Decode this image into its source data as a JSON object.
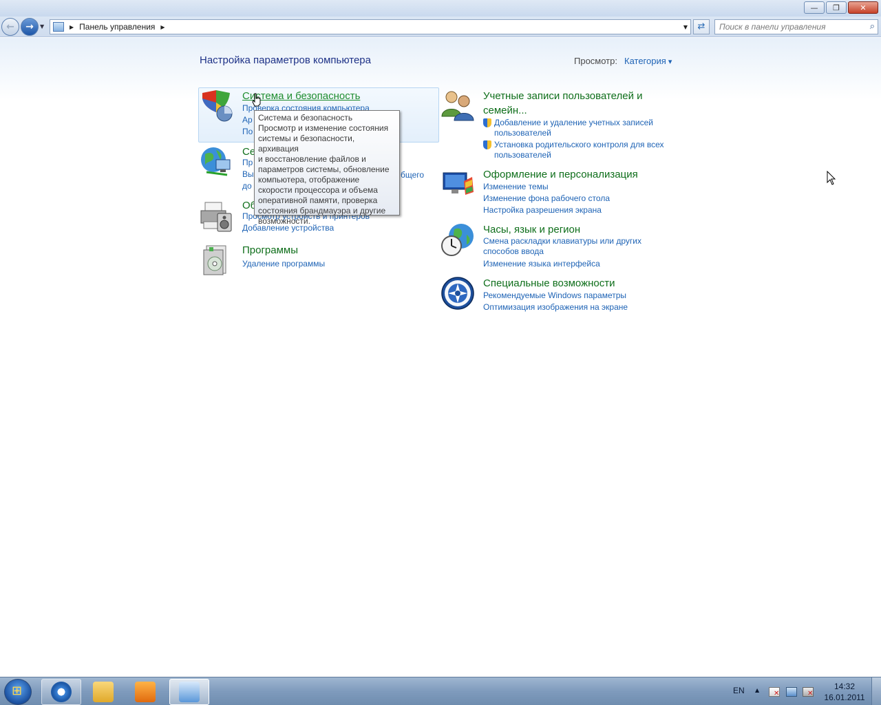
{
  "window": {
    "minimize_glyph": "—",
    "maximize_glyph": "❐",
    "close_glyph": "✕"
  },
  "nav": {
    "address_crumb": "Панель управления",
    "search_placeholder": "Поиск в панели управления"
  },
  "header": {
    "title": "Настройка параметров компьютера",
    "view_label": "Просмотр:",
    "view_value": "Категория"
  },
  "categories": {
    "system": {
      "title": "Система и безопасность",
      "links": [
        "Проверка состояния компьютера",
        "Ар",
        "По"
      ]
    },
    "network": {
      "title": "Се",
      "links": [
        "Пр",
        "Вы",
        "до"
      ],
      "fragment": "бщего"
    },
    "hardware": {
      "title": "Об",
      "links": [
        "Просмотр устройств и принтеров",
        "Добавление устройства"
      ]
    },
    "programs": {
      "title": "Программы",
      "links": [
        "Удаление программы"
      ]
    },
    "users": {
      "title_line1": "Учетные записи пользователей и",
      "title_line2": "семейн...",
      "links": [
        "Добавление и удаление учетных записей пользователей",
        "Установка родительского контроля для всех пользователей"
      ]
    },
    "appearance": {
      "title": "Оформление и персонализация",
      "links": [
        "Изменение темы",
        "Изменение фона рабочего стола",
        "Настройка разрешения экрана"
      ]
    },
    "clock": {
      "title": "Часы, язык и регион",
      "links": [
        "Смена раскладки клавиатуры или других способов ввода",
        "Изменение языка интерфейса"
      ]
    },
    "access": {
      "title": "Специальные возможности",
      "links": [
        "Рекомендуемые Windows параметры",
        "Оптимизация изображения на экране"
      ]
    }
  },
  "tooltip": {
    "lines": [
      "Система и безопасность",
      "Просмотр и изменение состояния",
      "системы и безопасности, архивация",
      "и восстановление файлов и",
      "параметров системы, обновление",
      "компьютера, отображение",
      "скорости процессора и объема",
      "оперативной памяти, проверка",
      "состояния брандмауэра и другие",
      "возможности."
    ]
  },
  "taskbar": {
    "language": "EN",
    "time": "14:32",
    "date": "16.01.2011"
  }
}
